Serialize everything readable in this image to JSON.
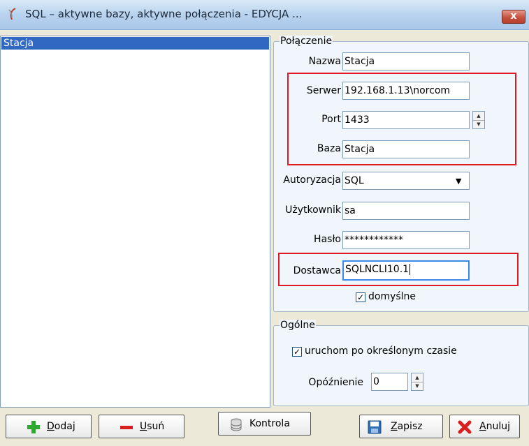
{
  "window": {
    "title": "SQL – aktywne bazy, aktywne połączenia - EDYCJA ...",
    "close_label": "x"
  },
  "list": {
    "items": [
      "Stacja"
    ]
  },
  "connection": {
    "legend": "Połączenie",
    "name_label": "Nazwa",
    "name_value": "Stacja",
    "server_label": "Serwer",
    "server_value": "192.168.1.13\\norcom",
    "port_label": "Port",
    "port_value": "1433",
    "database_label": "Baza",
    "database_value": "Stacja",
    "auth_label": "Autoryzacja",
    "auth_value": "SQL",
    "user_label": "Użytkownik",
    "user_value": "sa",
    "password_label": "Hasło",
    "password_value": "************",
    "provider_label": "Dostawca",
    "provider_value": "SQLNCLI10.1",
    "default_label": "domyślne",
    "default_checked": true
  },
  "general": {
    "legend": "Ogólne",
    "run_label": "uruchom po określonym czasie",
    "run_checked": true,
    "delay_label": "Opóźnienie",
    "delay_value": "0"
  },
  "buttons": {
    "add_hotkey": "D",
    "add_rest": "odaj",
    "remove_hotkey": "U",
    "remove_rest": "suń",
    "check_label": "Kontrola",
    "save_hotkey": "Z",
    "save_rest": "apisz",
    "cancel_hotkey": "A",
    "cancel_rest": "nuluj"
  },
  "colors": {
    "highlight_box": "#e01b24",
    "selection": "#3168c2",
    "add_icon": "#2ea82e",
    "remove_icon": "#d8201f"
  }
}
